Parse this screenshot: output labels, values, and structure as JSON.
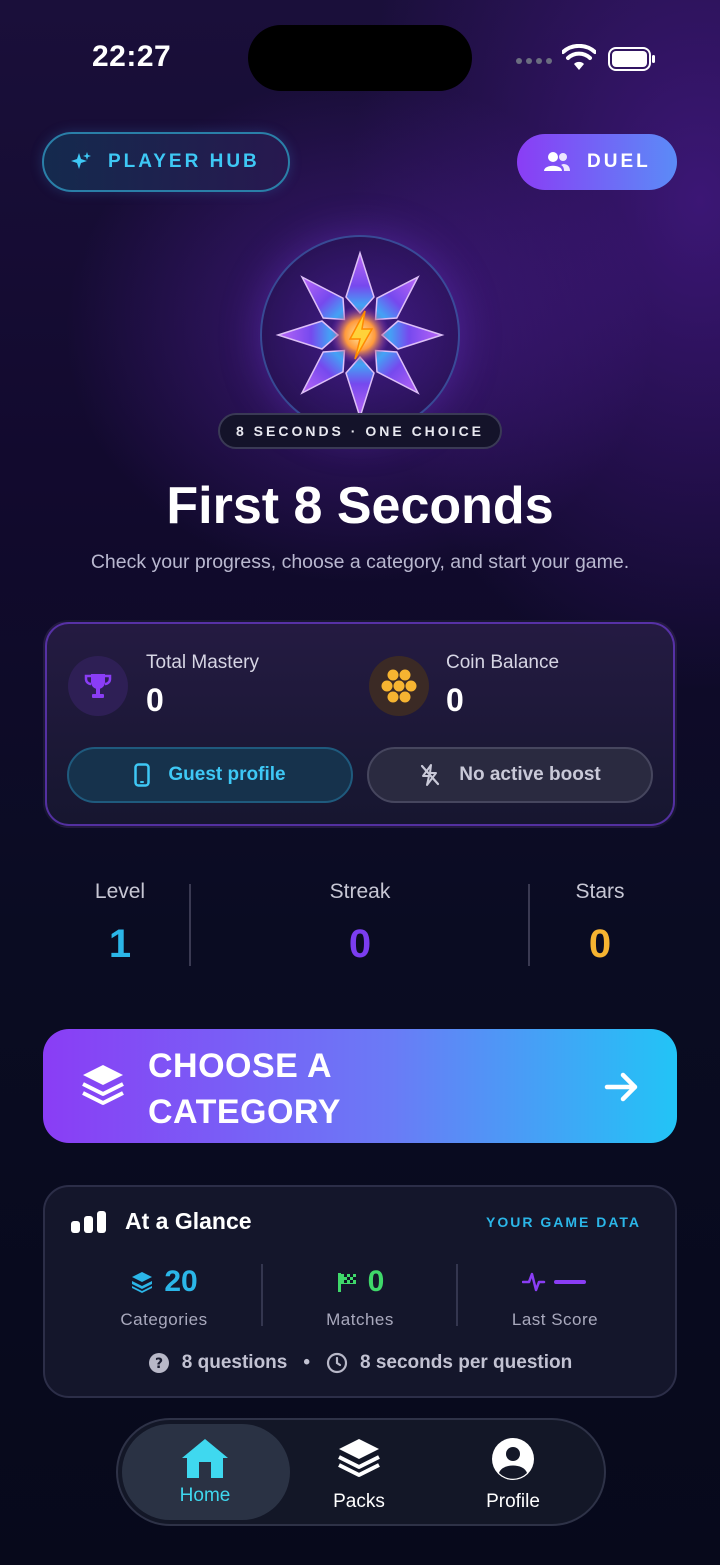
{
  "status_bar": {
    "time": "22:27"
  },
  "header": {
    "player_hub_label": "PLAYER HUB",
    "duel_label": "DUEL"
  },
  "hero": {
    "tagline": "8 SECONDS · ONE CHOICE",
    "title": "First 8 Seconds",
    "subtitle": "Check your progress, choose a category, and start your game."
  },
  "stats_card": {
    "mastery_label": "Total Mastery",
    "mastery_value": "0",
    "coin_label": "Coin Balance",
    "coin_value": "0",
    "profile_pill": "Guest profile",
    "boost_pill": "No active boost"
  },
  "progress_row": [
    {
      "label": "Level",
      "value": "1",
      "color": "#2bb6e8"
    },
    {
      "label": "Streak",
      "value": "0",
      "color": "#7b3df0"
    },
    {
      "label": "Stars",
      "value": "0",
      "color": "#f6b431"
    }
  ],
  "cta": {
    "label_line1": "CHOOSE A",
    "label_line2": "CATEGORY"
  },
  "glance": {
    "title": "At a Glance",
    "tag": "YOUR GAME DATA",
    "categories_value": "20",
    "categories_label": "Categories",
    "matches_value": "0",
    "matches_label": "Matches",
    "last_score_label": "Last Score",
    "questions_text": "8 questions",
    "separator": "•",
    "seconds_text": "8 seconds per question"
  },
  "tabs": [
    {
      "label": "Home",
      "icon": "home-icon",
      "active": true
    },
    {
      "label": "Packs",
      "icon": "layers-icon",
      "active": false
    },
    {
      "label": "Profile",
      "icon": "user-circle-icon",
      "active": false
    }
  ],
  "colors": {
    "accent_cyan": "#2bb6e8",
    "accent_purple": "#8a3df5",
    "gold": "#f6b431",
    "green": "#3fd86a"
  }
}
